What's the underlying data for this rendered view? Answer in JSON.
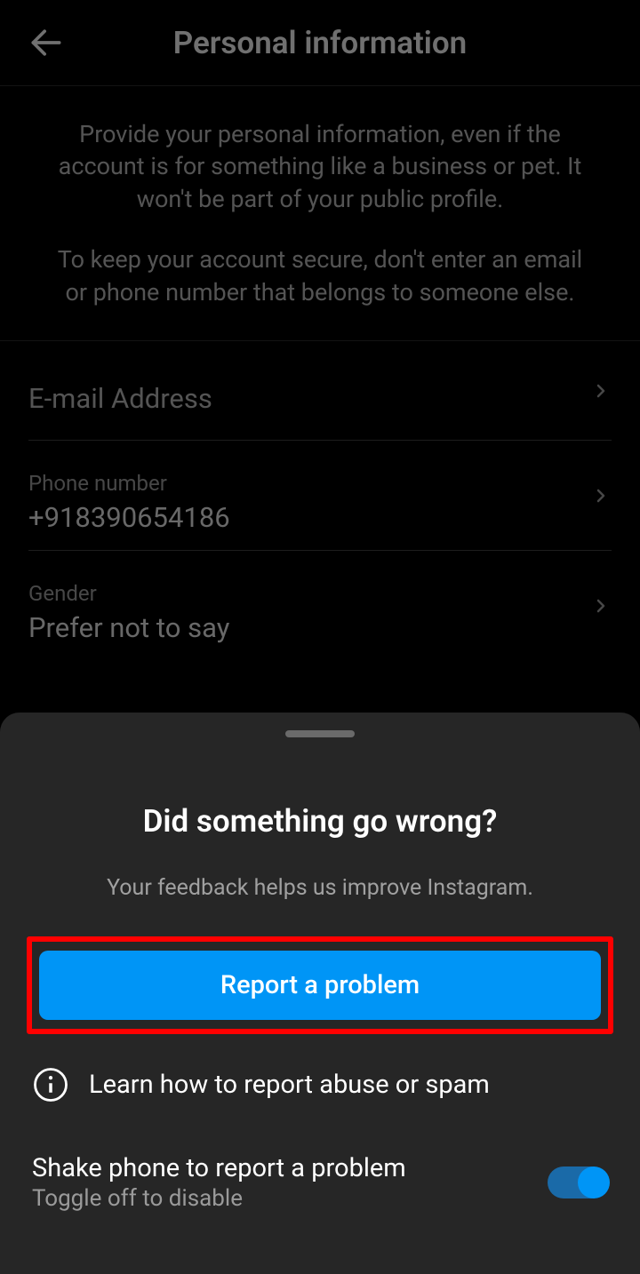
{
  "header": {
    "title": "Personal information"
  },
  "info": {
    "paragraph1": "Provide your personal information, even if the account is for something like a business or pet. It won't be part of your public profile.",
    "paragraph2": "To keep your account secure, don't enter an email or phone number that belongs to someone else."
  },
  "fields": {
    "email": {
      "label": "E-mail Address",
      "value": ""
    },
    "phone": {
      "label": "Phone number",
      "value": "+918390654186"
    },
    "gender": {
      "label": "Gender",
      "value": "Prefer not to say"
    }
  },
  "sheet": {
    "title": "Did something go wrong?",
    "subtitle": "Your feedback helps us improve Instagram.",
    "report_button": "Report a problem",
    "learn_link": "Learn how to report abuse or spam",
    "shake": {
      "title": "Shake phone to report a problem",
      "subtitle": "Toggle off to disable"
    }
  }
}
